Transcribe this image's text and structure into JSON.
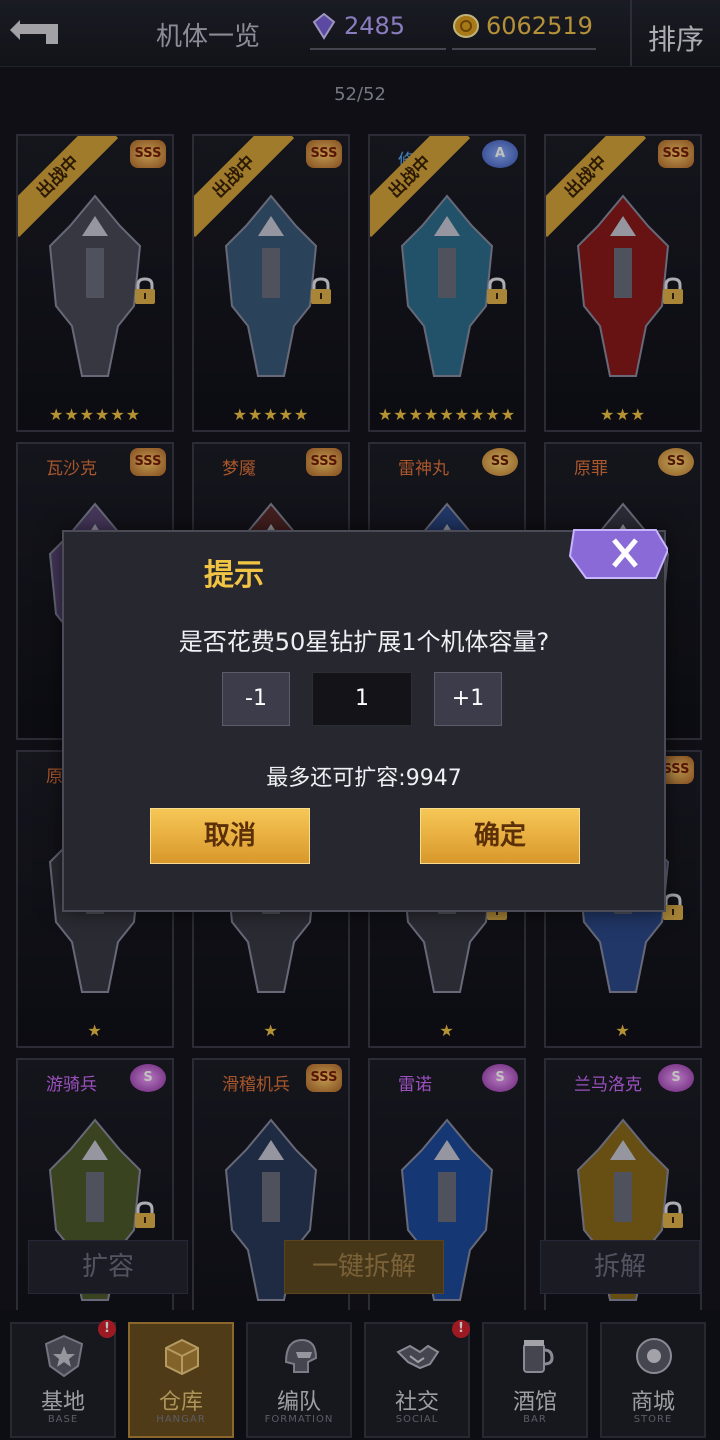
{
  "header": {
    "title": "机体一览",
    "gems": "2485",
    "coins": "6062519",
    "sort_label": "排序",
    "count": "52/52"
  },
  "cards": [
    {
      "name": "",
      "rank": "SSS",
      "deployed": true,
      "badge": "出战中",
      "stars": "★★★★★★",
      "locked": true
    },
    {
      "name": "",
      "rank": "SSS",
      "deployed": true,
      "badge": "出战中",
      "stars": "★★★★★",
      "locked": true
    },
    {
      "name": "修斯",
      "rank": "A",
      "deployed": true,
      "badge": "出战中",
      "stars": "★★★★★★★★★",
      "locked": true
    },
    {
      "name": "",
      "rank": "SSS",
      "deployed": true,
      "badge": "出战中",
      "stars": "★★★",
      "locked": true
    },
    {
      "name": "瓦沙克",
      "rank": "SSS",
      "deployed": false,
      "stars": "",
      "locked": false
    },
    {
      "name": "梦魇",
      "rank": "SSS",
      "deployed": false,
      "stars": "",
      "locked": false
    },
    {
      "name": "雷神丸",
      "rank": "SS",
      "deployed": false,
      "stars": "",
      "locked": false
    },
    {
      "name": "原罪",
      "rank": "SS",
      "deployed": false,
      "stars": "",
      "locked": false
    },
    {
      "name": "原",
      "rank": "",
      "deployed": false,
      "stars": "★",
      "locked": false
    },
    {
      "name": "",
      "rank": "",
      "deployed": false,
      "stars": "★",
      "locked": false
    },
    {
      "name": "",
      "rank": "",
      "deployed": false,
      "stars": "★",
      "locked": true
    },
    {
      "name": "",
      "rank": "SSS",
      "deployed": false,
      "stars": "★",
      "locked": true
    },
    {
      "name": "游骑兵",
      "rank": "S",
      "deployed": false,
      "stars": "",
      "locked": true
    },
    {
      "name": "滑稽机兵",
      "rank": "SSS",
      "deployed": false,
      "stars": "",
      "locked": false
    },
    {
      "name": "雷诺",
      "rank": "S",
      "deployed": false,
      "stars": "",
      "locked": false
    },
    {
      "name": "兰马洛克",
      "rank": "S",
      "deployed": false,
      "stars": "",
      "locked": true
    }
  ],
  "actions": {
    "expand": "扩容",
    "one_key": "一键拆解",
    "dismantle": "拆解"
  },
  "nav": [
    {
      "label": "基地",
      "sub": "BASE",
      "alert": true
    },
    {
      "label": "仓库",
      "sub": "HANGAR",
      "alert": false
    },
    {
      "label": "编队",
      "sub": "FORMATION",
      "alert": false
    },
    {
      "label": "社交",
      "sub": "SOCIAL",
      "alert": true
    },
    {
      "label": "酒馆",
      "sub": "BAR",
      "alert": false
    },
    {
      "label": "商城",
      "sub": "STORE",
      "alert": false
    }
  ],
  "dialog": {
    "title": "提示",
    "message": "是否花费50星钻扩展1个机体容量?",
    "minus": "-1",
    "qty": "1",
    "plus": "+1",
    "remain": "最多还可扩容:9947",
    "cancel": "取消",
    "ok": "确定"
  },
  "colors": {
    "gold": "#f2c444",
    "dialog_bg": "#27272f",
    "accent_purple": "#8a6ad6"
  }
}
